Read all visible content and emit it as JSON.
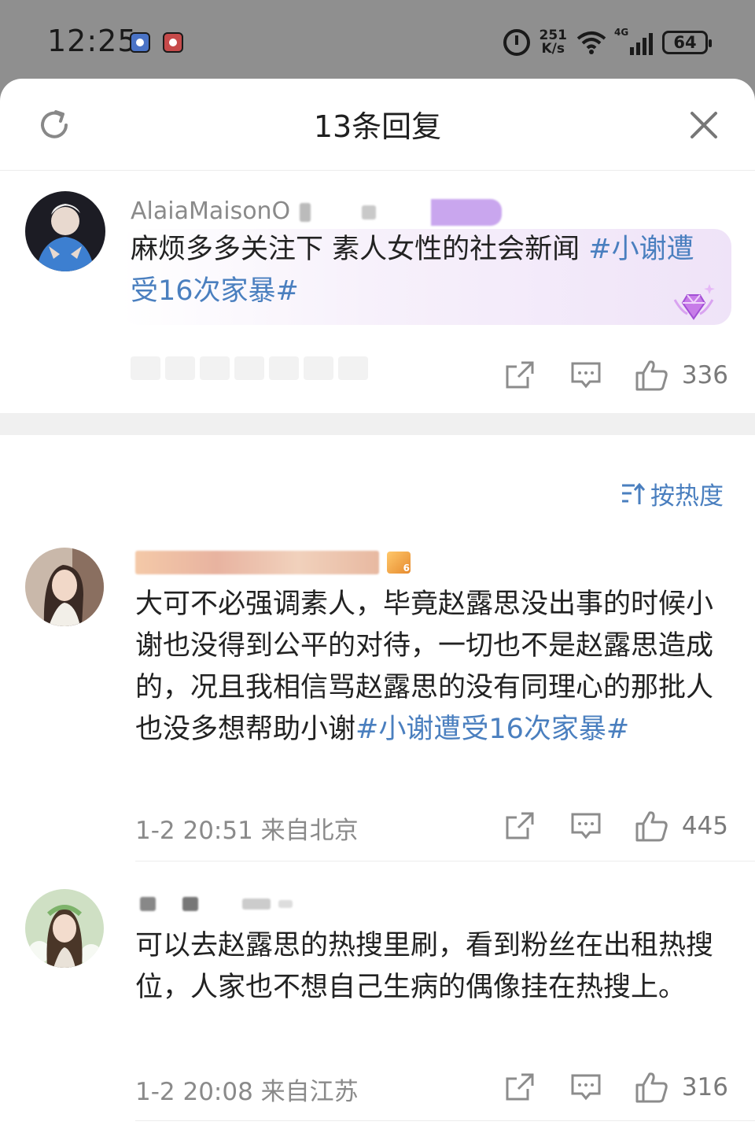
{
  "status_bar": {
    "time": "12:25",
    "net_speed_value": "251",
    "net_speed_unit": "K/s",
    "signal_label": "4G",
    "battery": "64"
  },
  "header": {
    "title": "13条回复"
  },
  "root_comment": {
    "username": "AlaiaMaisonO",
    "text_plain": "麻烦多多关注下 素人女性的社会新闻 ",
    "text_tag": "#小谢遭受16次家暴#",
    "like_count": "336"
  },
  "sort": {
    "label": "按热度"
  },
  "replies": [
    {
      "text_plain": "大可不必强调素人，毕竟赵露思没出事的时候小谢也没得到公平的对待，一切也不是赵露思造成的，况且我相信骂赵露思的没有同理心的那批人也没多想帮助小谢",
      "text_tag": "#小谢遭受16次家暴#",
      "meta": "1-2 20:51 来自北京",
      "like_count": "445"
    },
    {
      "text_plain": "可以去赵露思的热搜里刷，看到粉丝在出租热搜位，人家也不想自己生病的偶像挂在热搜上。",
      "text_tag": "",
      "meta": "1-2 20:08 来自江苏",
      "like_count": "316"
    }
  ],
  "colors": {
    "accent": "#4a7fbf",
    "meta_gray": "#8a8a8a",
    "status_bg": "#8f8f8f"
  },
  "icons": {
    "refresh": "refresh-icon",
    "close": "close-icon",
    "share": "share-icon",
    "comment": "comment-icon",
    "like": "thumbs-up-icon",
    "sort": "sort-icon",
    "badge": "gem-badge-icon"
  }
}
